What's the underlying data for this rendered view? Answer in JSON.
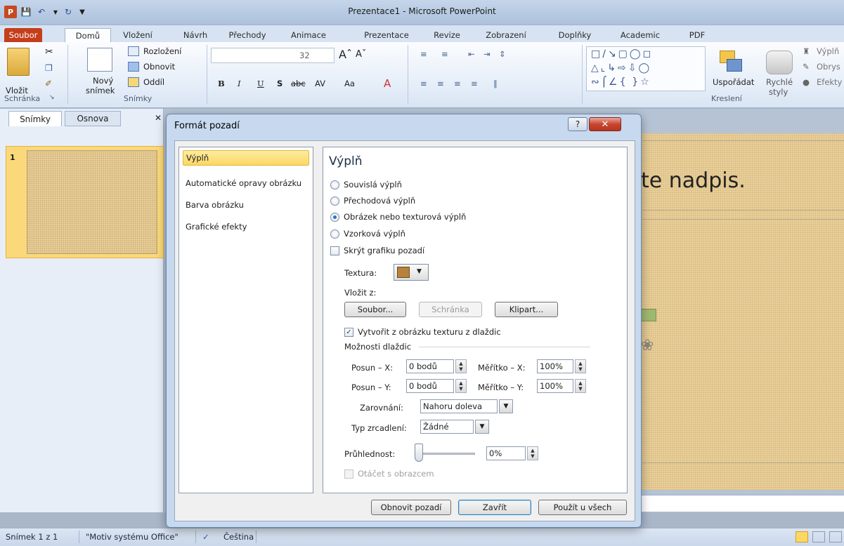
{
  "window": {
    "title": "Prezentace1 - Microsoft PowerPoint"
  },
  "tabs": [
    "Soubor",
    "Domů",
    "Vložení",
    "Návrh",
    "Přechody",
    "Animace",
    "Prezentace",
    "Revize",
    "Zobrazení",
    "Doplňky",
    "Academic",
    "PDF"
  ],
  "ribbon": {
    "paste_label": "Vložit",
    "new_slide_label_1": "Nový",
    "new_slide_label_2": "snímek",
    "layout_label": "Rozložení",
    "reset_label": "Obnovit",
    "section_label": "Oddíl",
    "font_size": "32",
    "arrange_label": "Uspořádat",
    "quick_styles_1": "Rychlé",
    "quick_styles_2": "styly",
    "shape_fill": "Výplň",
    "shape_outline": "Obrys",
    "shape_effects": "Efekty",
    "groups": {
      "clipboard": "Schránka",
      "slides": "Snímky",
      "drawing": "Kreslení"
    }
  },
  "left_panel": {
    "tab_slides": "Snímky",
    "tab_outline": "Osnova",
    "slide_number": "1"
  },
  "slide": {
    "title_placeholder": "te nadpis."
  },
  "status": {
    "slide_info": "Snímek 1 z 1",
    "theme": "\"Motiv systému Office\"",
    "language": "Čeština"
  },
  "dialog": {
    "title": "Formát pozadí",
    "nav": [
      "Výplň",
      "Automatické opravy obrázku",
      "Barva obrázku",
      "Grafické efekty"
    ],
    "pane_title": "Výplň",
    "fill_options": [
      "Souvislá výplň",
      "Přechodová výplň",
      "Obrázek nebo texturová výplň",
      "Vzorková výplň"
    ],
    "selected_fill": "Obrázek nebo texturová výplň",
    "hide_graphics": "Skrýt grafiku pozadí",
    "texture_label": "Textura:",
    "insert_from": "Vložit z:",
    "btn_file": "Soubor...",
    "btn_clipboard": "Schránka",
    "btn_clipart": "Klipart...",
    "tile_checkbox": "Vytvořit z obrázku texturu z dlaždic",
    "tile_options": "Možnosti dlaždic",
    "offset_x_label": "Posun – X:",
    "offset_x_value": "0 bodů",
    "scale_x_label": "Měřítko – X:",
    "scale_x_value": "100%",
    "offset_y_label": "Posun – Y:",
    "offset_y_value": "0 bodů",
    "scale_y_label": "Měřítko – Y:",
    "scale_y_value": "100%",
    "alignment_label": "Zarovnání:",
    "alignment_value": "Nahoru doleva",
    "mirror_label": "Typ zrcadlení:",
    "mirror_value": "Žádné",
    "transparency_label": "Průhlednost:",
    "transparency_value": "0%",
    "transparency_fraction": 0.0,
    "rotate_label": "Otáčet s obrazcem",
    "btn_reset": "Obnovit pozadí",
    "btn_close": "Zavřít",
    "btn_apply_all": "Použít u všech"
  },
  "colors": {
    "file_tab": "#c43e1c",
    "nav_selected": "#fbd865",
    "dialog_frame": "#c7d9ef"
  }
}
